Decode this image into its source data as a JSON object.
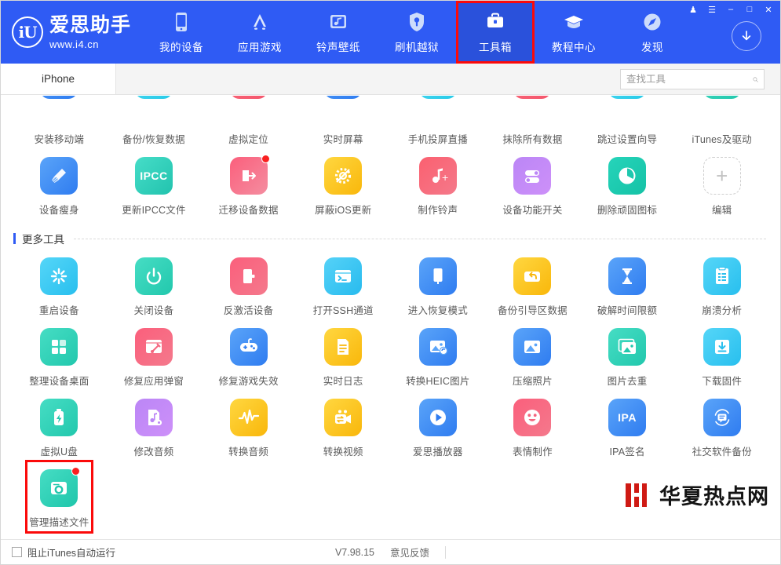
{
  "window": {
    "controls": [
      {
        "name": "skin-icon",
        "glyph": "♟"
      },
      {
        "name": "menu-icon",
        "glyph": "☰"
      },
      {
        "name": "minimize-icon",
        "glyph": "–"
      },
      {
        "name": "maximize-icon",
        "glyph": "□"
      },
      {
        "name": "close-icon",
        "glyph": "✕"
      }
    ]
  },
  "brand": {
    "mark": "iU",
    "name": "爱思助手",
    "url": "www.i4.cn"
  },
  "nav": {
    "items": [
      {
        "label": "我的设备",
        "icon": "phone-icon",
        "active": false,
        "highlighted": false
      },
      {
        "label": "应用游戏",
        "icon": "appstore-icon",
        "active": false,
        "highlighted": false
      },
      {
        "label": "铃声壁纸",
        "icon": "music-folder-icon",
        "active": false,
        "highlighted": false
      },
      {
        "label": "刷机越狱",
        "icon": "shield-key-icon",
        "active": false,
        "highlighted": false
      },
      {
        "label": "工具箱",
        "icon": "toolbox-icon",
        "active": true,
        "highlighted": true
      },
      {
        "label": "教程中心",
        "icon": "graduation-cap-icon",
        "active": false,
        "highlighted": false
      },
      {
        "label": "发现",
        "icon": "compass-icon",
        "active": false,
        "highlighted": false
      }
    ],
    "download_icon": "download-circle-icon"
  },
  "tabs": {
    "device_tab": "iPhone"
  },
  "search": {
    "placeholder": "查找工具",
    "value": "",
    "icon": "search-icon"
  },
  "toolbox": {
    "pinned_row_clipped": [
      {
        "label": "安装移动端",
        "color": "#3f7ff5",
        "icon": "install-mobile-icon"
      },
      {
        "label": "备份/恢复数据",
        "color": "#27d7e7",
        "icon": "backup-restore-icon"
      },
      {
        "label": "虚拟定位",
        "color": "#fb5b6a",
        "icon": "virtual-location-icon"
      },
      {
        "label": "实时屏幕",
        "color": "#3f7ff5",
        "icon": "realtime-screen-icon"
      },
      {
        "label": "手机投屏直播",
        "color": "#27d7e7",
        "icon": "screen-cast-icon"
      },
      {
        "label": "抹除所有数据",
        "color": "#fb5b6a",
        "icon": "erase-data-icon"
      },
      {
        "label": "跳过设置向导",
        "color": "#27d7e7",
        "icon": "skip-setup-icon"
      },
      {
        "label": "iTunes及驱动",
        "color": "#22d3b8",
        "icon": "itunes-driver-icon"
      }
    ],
    "pinned_row_two": [
      {
        "label": "设备瘦身",
        "icon": "broom-icon",
        "bg1": "#4f9cf8",
        "bg2": "#2f7cf0",
        "badge": false
      },
      {
        "label": "更新IPCC文件",
        "icon": "ipcc-icon",
        "bg1": "#3fd9c4",
        "bg2": "#24c2ae",
        "badge": false
      },
      {
        "label": "迁移设备数据",
        "icon": "migrate-icon",
        "bg1": "#fb5f7c",
        "bg2": "#f3879a",
        "badge": true
      },
      {
        "label": "屏蔽iOS更新",
        "icon": "block-update-icon",
        "bg1": "#ffcf33",
        "bg2": "#f9bb0e",
        "badge": false
      },
      {
        "label": "制作铃声",
        "icon": "ringtone-icon",
        "bg1": "#fb6070",
        "bg2": "#f4798a",
        "badge": false
      },
      {
        "label": "设备功能开关",
        "icon": "toggles-icon",
        "bg1": "#b981f5",
        "bg2": "#cb8df8",
        "badge": false
      },
      {
        "label": "删除顽固图标",
        "icon": "clock-icon",
        "bg1": "#22cfb4",
        "bg2": "#19c3a6",
        "badge": false
      },
      {
        "label": "编辑",
        "icon": "plus-icon",
        "bg1": "#ffffff",
        "bg2": "#ffffff",
        "badge": false,
        "edit": true
      }
    ],
    "more_tools_title": "更多工具",
    "more_tools": [
      {
        "label": "重启设备",
        "icon": "restart-icon",
        "bg1": "#4fd2f7",
        "bg2": "#2bc0ee",
        "badge": false
      },
      {
        "label": "关闭设备",
        "icon": "power-icon",
        "bg1": "#3fd9c0",
        "bg2": "#24c8ad",
        "badge": false
      },
      {
        "label": "反激活设备",
        "icon": "deactivate-icon",
        "bg1": "#fb5f7c",
        "bg2": "#f4798c",
        "badge": false
      },
      {
        "label": "打开SSH通道",
        "icon": "terminal-icon",
        "bg1": "#4fcff7",
        "bg2": "#2bbbee",
        "badge": false
      },
      {
        "label": "进入恢复模式",
        "icon": "recovery-icon",
        "bg1": "#4f9cf8",
        "bg2": "#2f7cf0",
        "badge": false
      },
      {
        "label": "备份引导区数据",
        "icon": "boot-backup-icon",
        "bg1": "#ffcf33",
        "bg2": "#f9bb0e",
        "badge": false
      },
      {
        "label": "破解时间限额",
        "icon": "hourglass-icon",
        "bg1": "#4f9cf8",
        "bg2": "#2f7cf0",
        "badge": false
      },
      {
        "label": "崩溃分析",
        "icon": "crash-report-icon",
        "bg1": "#4fd2f7",
        "bg2": "#2bc0ee",
        "badge": false
      },
      {
        "label": "整理设备桌面",
        "icon": "grid-tiles-icon",
        "bg1": "#3fd9c0",
        "bg2": "#24c8ad",
        "badge": false
      },
      {
        "label": "修复应用弹窗",
        "icon": "fix-popup-icon",
        "bg1": "#fb5f7c",
        "bg2": "#f4798c",
        "badge": false
      },
      {
        "label": "修复游戏失效",
        "icon": "gamepad-icon",
        "bg1": "#4f9cf8",
        "bg2": "#2f7cf0",
        "badge": false
      },
      {
        "label": "实时日志",
        "icon": "log-file-icon",
        "bg1": "#ffcf33",
        "bg2": "#f9bb0e",
        "badge": false
      },
      {
        "label": "转换HEIC图片",
        "icon": "heic-convert-icon",
        "bg1": "#4f9cf8",
        "bg2": "#2f7cf0",
        "badge": false
      },
      {
        "label": "压缩照片",
        "icon": "compress-photo-icon",
        "bg1": "#4f9cf8",
        "bg2": "#2f7cf0",
        "badge": false
      },
      {
        "label": "图片去重",
        "icon": "dedupe-photo-icon",
        "bg1": "#3fd9c0",
        "bg2": "#24c8ad",
        "badge": false
      },
      {
        "label": "下载固件",
        "icon": "download-firmware-icon",
        "bg1": "#4fd2f7",
        "bg2": "#2bc0ee",
        "badge": false
      },
      {
        "label": "虚拟U盘",
        "icon": "usb-drive-icon",
        "bg1": "#3fd9c0",
        "bg2": "#24c8ad",
        "badge": false
      },
      {
        "label": "修改音频",
        "icon": "edit-audio-icon",
        "bg1": "#b981f5",
        "bg2": "#cb8df8",
        "badge": false
      },
      {
        "label": "转换音频",
        "icon": "waveform-icon",
        "bg1": "#ffcf33",
        "bg2": "#f9bb0e",
        "badge": false
      },
      {
        "label": "转换视频",
        "icon": "video-convert-icon",
        "bg1": "#ffcf33",
        "bg2": "#f9bb0e",
        "badge": false
      },
      {
        "label": "爱思播放器",
        "icon": "play-icon",
        "bg1": "#4f9cf8",
        "bg2": "#2f7cf0",
        "badge": false
      },
      {
        "label": "表情制作",
        "icon": "emoji-icon",
        "bg1": "#fb5f7c",
        "bg2": "#f4798c",
        "badge": false
      },
      {
        "label": "IPA签名",
        "icon": "ipa-sign-icon",
        "bg1": "#4f9cf8",
        "bg2": "#2f7cf0",
        "badge": false
      },
      {
        "label": "社交软件备份",
        "icon": "social-backup-icon",
        "bg1": "#4f9cf8",
        "bg2": "#2f7cf0",
        "badge": false
      },
      {
        "label": "管理描述文件",
        "icon": "profile-manage-icon",
        "bg1": "#3fd9c0",
        "bg2": "#24c8ad",
        "badge": true,
        "selected": true
      }
    ]
  },
  "footer": {
    "checkbox_label": "阻止iTunes自动运行",
    "checkbox_checked": false,
    "version": "V7.98.15",
    "feedback": "意见反馈"
  },
  "watermark": {
    "text": "华夏热点网",
    "accent": "#cf1a14"
  },
  "colors": {
    "header_blue": "#2f5bf4",
    "highlight_red": "#fb0a0a",
    "accent_blue": "#2f5bf4"
  }
}
